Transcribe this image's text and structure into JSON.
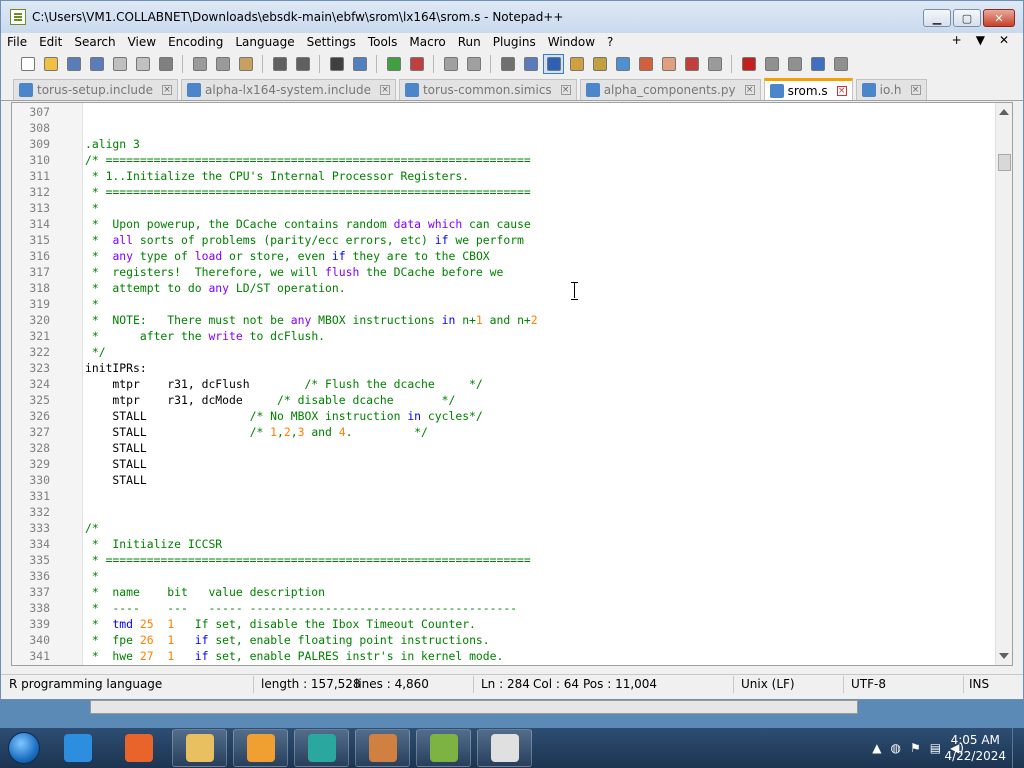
{
  "window": {
    "title": "C:\\Users\\VM1.COLLABNET\\Downloads\\ebsdk-main\\ebfw\\srom\\lx164\\srom.s - Notepad++",
    "controls": [
      "minimize",
      "maximize",
      "close"
    ]
  },
  "menu": {
    "items": [
      "File",
      "Edit",
      "Search",
      "View",
      "Encoding",
      "Language",
      "Settings",
      "Tools",
      "Macro",
      "Run",
      "Plugins",
      "Window",
      "?"
    ],
    "right": [
      "+",
      "▼",
      "✕"
    ]
  },
  "toolbar": {
    "buttons": [
      {
        "name": "new-file-icon",
        "color": "#ffffff"
      },
      {
        "name": "open-file-icon",
        "color": "#f0c040"
      },
      {
        "name": "save-icon",
        "color": "#5a7cb8"
      },
      {
        "name": "save-all-icon",
        "color": "#5a7cb8"
      },
      {
        "name": "close-icon",
        "color": "#c0c0c0"
      },
      {
        "name": "close-all-icon",
        "color": "#c0c0c0"
      },
      {
        "name": "print-icon",
        "color": "#808080"
      },
      {
        "name": "sep"
      },
      {
        "name": "cut-icon",
        "color": "#9a9a9a"
      },
      {
        "name": "copy-icon",
        "color": "#9a9a9a"
      },
      {
        "name": "paste-icon",
        "color": "#c8a060"
      },
      {
        "name": "sep"
      },
      {
        "name": "undo-icon",
        "color": "#606060"
      },
      {
        "name": "redo-icon",
        "color": "#606060"
      },
      {
        "name": "sep"
      },
      {
        "name": "find-icon",
        "color": "#404040"
      },
      {
        "name": "replace-icon",
        "color": "#5080c0"
      },
      {
        "name": "sep"
      },
      {
        "name": "zoom-in-icon",
        "color": "#40a040"
      },
      {
        "name": "zoom-out-icon",
        "color": "#c04040"
      },
      {
        "name": "sep"
      },
      {
        "name": "sync-vertical-icon",
        "color": "#a0a0a0"
      },
      {
        "name": "sync-horizontal-icon",
        "color": "#a0a0a0"
      },
      {
        "name": "sep"
      },
      {
        "name": "word-wrap-icon",
        "color": "#707070"
      },
      {
        "name": "show-all-chars-icon",
        "color": "#5a7cb8"
      },
      {
        "name": "indent-guide-icon",
        "color": "#3060b0",
        "active": true
      },
      {
        "name": "lang-udl-icon",
        "color": "#d0a040"
      },
      {
        "name": "doc-map-icon",
        "color": "#c0a040"
      },
      {
        "name": "doc-list-icon",
        "color": "#5090d0"
      },
      {
        "name": "function-list-icon",
        "color": "#d06040"
      },
      {
        "name": "folder-workspace-icon",
        "color": "#e0a080"
      },
      {
        "name": "monitoring-icon",
        "color": "#c04040"
      },
      {
        "name": "preview-icon",
        "color": "#9a9a9a"
      },
      {
        "name": "sep"
      },
      {
        "name": "record-macro-icon",
        "color": "#c02020"
      },
      {
        "name": "stop-record-icon",
        "color": "#909090"
      },
      {
        "name": "play-macro-icon",
        "color": "#909090"
      },
      {
        "name": "run-macro-multiple-icon",
        "color": "#4070c0"
      },
      {
        "name": "save-macro-icon",
        "color": "#909090"
      }
    ]
  },
  "tabs": [
    {
      "label": "torus-setup.include",
      "active": false
    },
    {
      "label": "alpha-lx164-system.include",
      "active": false
    },
    {
      "label": "torus-common.simics",
      "active": false
    },
    {
      "label": "alpha_components.py",
      "active": false
    },
    {
      "label": "srom.s",
      "active": true
    },
    {
      "label": "io.h",
      "active": false
    }
  ],
  "editor": {
    "lines": [
      {
        "n": "307",
        "segs": [
          {
            "t": "",
            "c": "g"
          }
        ]
      },
      {
        "n": "308",
        "segs": [
          {
            "t": "",
            "c": "g"
          }
        ]
      },
      {
        "n": "309",
        "segs": [
          {
            "t": ".align 3",
            "c": "g"
          }
        ]
      },
      {
        "n": "310",
        "segs": [
          {
            "t": "/* ==============================================================",
            "c": "g"
          }
        ]
      },
      {
        "n": "311",
        "segs": [
          {
            "t": " * 1..Initialize the CPU's Internal Processor Registers.",
            "c": "g"
          }
        ]
      },
      {
        "n": "312",
        "segs": [
          {
            "t": " * ==============================================================",
            "c": "g"
          }
        ]
      },
      {
        "n": "313",
        "segs": [
          {
            "t": " *",
            "c": "g"
          }
        ]
      },
      {
        "n": "314",
        "segs": [
          {
            "t": " *  Upon powerup, the DCache contains random ",
            "c": "g"
          },
          {
            "t": "data",
            "c": "kw"
          },
          {
            "t": " ",
            "c": "g"
          },
          {
            "t": "which",
            "c": "kw"
          },
          {
            "t": " can cause",
            "c": "g"
          }
        ]
      },
      {
        "n": "315",
        "segs": [
          {
            "t": " *  ",
            "c": "g"
          },
          {
            "t": "all",
            "c": "kw"
          },
          {
            "t": " sorts of problems (parity/ecc errors, etc) ",
            "c": "g"
          },
          {
            "t": "if",
            "c": "kb"
          },
          {
            "t": " we perform",
            "c": "g"
          }
        ]
      },
      {
        "n": "316",
        "segs": [
          {
            "t": " *  ",
            "c": "g"
          },
          {
            "t": "any",
            "c": "kw"
          },
          {
            "t": " type of ",
            "c": "g"
          },
          {
            "t": "load",
            "c": "kw"
          },
          {
            "t": " or store, even ",
            "c": "g"
          },
          {
            "t": "if",
            "c": "kb"
          },
          {
            "t": " they are to the CBOX",
            "c": "g"
          }
        ]
      },
      {
        "n": "317",
        "segs": [
          {
            "t": " *  registers!  Therefore, we will ",
            "c": "g"
          },
          {
            "t": "flush",
            "c": "kw"
          },
          {
            "t": " the DCache before we",
            "c": "g"
          }
        ]
      },
      {
        "n": "318",
        "segs": [
          {
            "t": " *  attempt to do ",
            "c": "g"
          },
          {
            "t": "any",
            "c": "kw"
          },
          {
            "t": " LD/ST operation.",
            "c": "g"
          }
        ]
      },
      {
        "n": "319",
        "segs": [
          {
            "t": " *",
            "c": "g"
          }
        ]
      },
      {
        "n": "320",
        "segs": [
          {
            "t": " *  NOTE:   There must not be ",
            "c": "g"
          },
          {
            "t": "any",
            "c": "kw"
          },
          {
            "t": " MBOX instructions ",
            "c": "g"
          },
          {
            "t": "in",
            "c": "kb"
          },
          {
            "t": " n+",
            "c": "g"
          },
          {
            "t": "1",
            "c": "num"
          },
          {
            "t": " and n+",
            "c": "g"
          },
          {
            "t": "2",
            "c": "num"
          }
        ]
      },
      {
        "n": "321",
        "segs": [
          {
            "t": " *      after the ",
            "c": "g"
          },
          {
            "t": "write",
            "c": "kw"
          },
          {
            "t": " to dcFlush.",
            "c": "g"
          }
        ]
      },
      {
        "n": "322",
        "segs": [
          {
            "t": " */",
            "c": "g"
          }
        ]
      },
      {
        "n": "323",
        "segs": [
          {
            "t": "initIPRs:",
            "c": "p"
          }
        ]
      },
      {
        "n": "324",
        "segs": [
          {
            "t": "    mtpr    r31, dcFlush        ",
            "c": "p"
          },
          {
            "t": "/* Flush the dcache     */",
            "c": "g"
          }
        ]
      },
      {
        "n": "325",
        "segs": [
          {
            "t": "    mtpr    r31, dcMode     ",
            "c": "p"
          },
          {
            "t": "/* disable dcache       */",
            "c": "g"
          }
        ]
      },
      {
        "n": "326",
        "segs": [
          {
            "t": "    STALL               ",
            "c": "p"
          },
          {
            "t": "/* No MBOX instruction ",
            "c": "g"
          },
          {
            "t": "in",
            "c": "kb"
          },
          {
            "t": " cycles*/",
            "c": "g"
          }
        ]
      },
      {
        "n": "327",
        "segs": [
          {
            "t": "    STALL               ",
            "c": "p"
          },
          {
            "t": "/* ",
            "c": "g"
          },
          {
            "t": "1",
            "c": "num"
          },
          {
            "t": ",",
            "c": "g"
          },
          {
            "t": "2",
            "c": "num"
          },
          {
            "t": ",",
            "c": "g"
          },
          {
            "t": "3",
            "c": "num"
          },
          {
            "t": " and ",
            "c": "g"
          },
          {
            "t": "4",
            "c": "num"
          },
          {
            "t": ".         */",
            "c": "g"
          }
        ]
      },
      {
        "n": "328",
        "segs": [
          {
            "t": "    STALL",
            "c": "p"
          }
        ]
      },
      {
        "n": "329",
        "segs": [
          {
            "t": "    STALL",
            "c": "p"
          }
        ]
      },
      {
        "n": "330",
        "segs": [
          {
            "t": "    STALL",
            "c": "p"
          }
        ]
      },
      {
        "n": "331",
        "segs": [
          {
            "t": "",
            "c": "p"
          }
        ]
      },
      {
        "n": "332",
        "segs": [
          {
            "t": "",
            "c": "p"
          }
        ]
      },
      {
        "n": "333",
        "segs": [
          {
            "t": "/*",
            "c": "g"
          }
        ]
      },
      {
        "n": "334",
        "segs": [
          {
            "t": " *  Initialize ICCSR",
            "c": "g"
          }
        ]
      },
      {
        "n": "335",
        "segs": [
          {
            "t": " * ==============================================================",
            "c": "g"
          }
        ]
      },
      {
        "n": "336",
        "segs": [
          {
            "t": " *",
            "c": "g"
          }
        ]
      },
      {
        "n": "337",
        "segs": [
          {
            "t": " *  name    bit   value description",
            "c": "g"
          }
        ]
      },
      {
        "n": "338",
        "segs": [
          {
            "t": " *  ----    ---   ----- ---------------------------------------",
            "c": "g"
          }
        ]
      },
      {
        "n": "339",
        "segs": [
          {
            "t": " *  ",
            "c": "g"
          },
          {
            "t": "tmd",
            "c": "kb"
          },
          {
            "t": " ",
            "c": "g"
          },
          {
            "t": "25",
            "c": "num"
          },
          {
            "t": "  ",
            "c": "g"
          },
          {
            "t": "1",
            "c": "num"
          },
          {
            "t": "   If set, disable the Ibox Timeout Counter.",
            "c": "g"
          }
        ]
      },
      {
        "n": "340",
        "segs": [
          {
            "t": " *  fpe ",
            "c": "g"
          },
          {
            "t": "26",
            "c": "num"
          },
          {
            "t": "  ",
            "c": "g"
          },
          {
            "t": "1",
            "c": "num"
          },
          {
            "t": "   ",
            "c": "g"
          },
          {
            "t": "if",
            "c": "kb"
          },
          {
            "t": " set, enable floating point instructions.",
            "c": "g"
          }
        ]
      },
      {
        "n": "341",
        "segs": [
          {
            "t": " *  hwe ",
            "c": "g"
          },
          {
            "t": "27",
            "c": "num"
          },
          {
            "t": "  ",
            "c": "g"
          },
          {
            "t": "1",
            "c": "num"
          },
          {
            "t": "   ",
            "c": "g"
          },
          {
            "t": "if",
            "c": "kb"
          },
          {
            "t": " set, enable PALRES instr's in kernel mode.",
            "c": "g"
          }
        ]
      }
    ]
  },
  "status": {
    "language": "R programming language",
    "length": "length : 157,528",
    "lines": "lines : 4,860",
    "ln": "Ln : 284",
    "col": "Col : 64",
    "pos": "Pos : 11,004",
    "eol": "Unix (LF)",
    "encoding": "UTF-8",
    "mode": "INS"
  },
  "taskbar": {
    "apps": [
      {
        "name": "internet-explorer-icon",
        "color": "#2d8ee0"
      },
      {
        "name": "firefox-icon",
        "color": "#e8642a"
      },
      {
        "name": "file-explorer-icon",
        "color": "#e8c060"
      },
      {
        "name": "media-player-icon",
        "color": "#f0a030"
      },
      {
        "name": "app-teal-icon",
        "color": "#2aa8a0"
      },
      {
        "name": "app-orange-icon",
        "color": "#d08040"
      },
      {
        "name": "notepadpp-icon",
        "color": "#7cb342"
      },
      {
        "name": "hxd-icon",
        "color": "#e0e0e0"
      }
    ],
    "time": "4:05 AM",
    "date": "4/22/2024"
  }
}
